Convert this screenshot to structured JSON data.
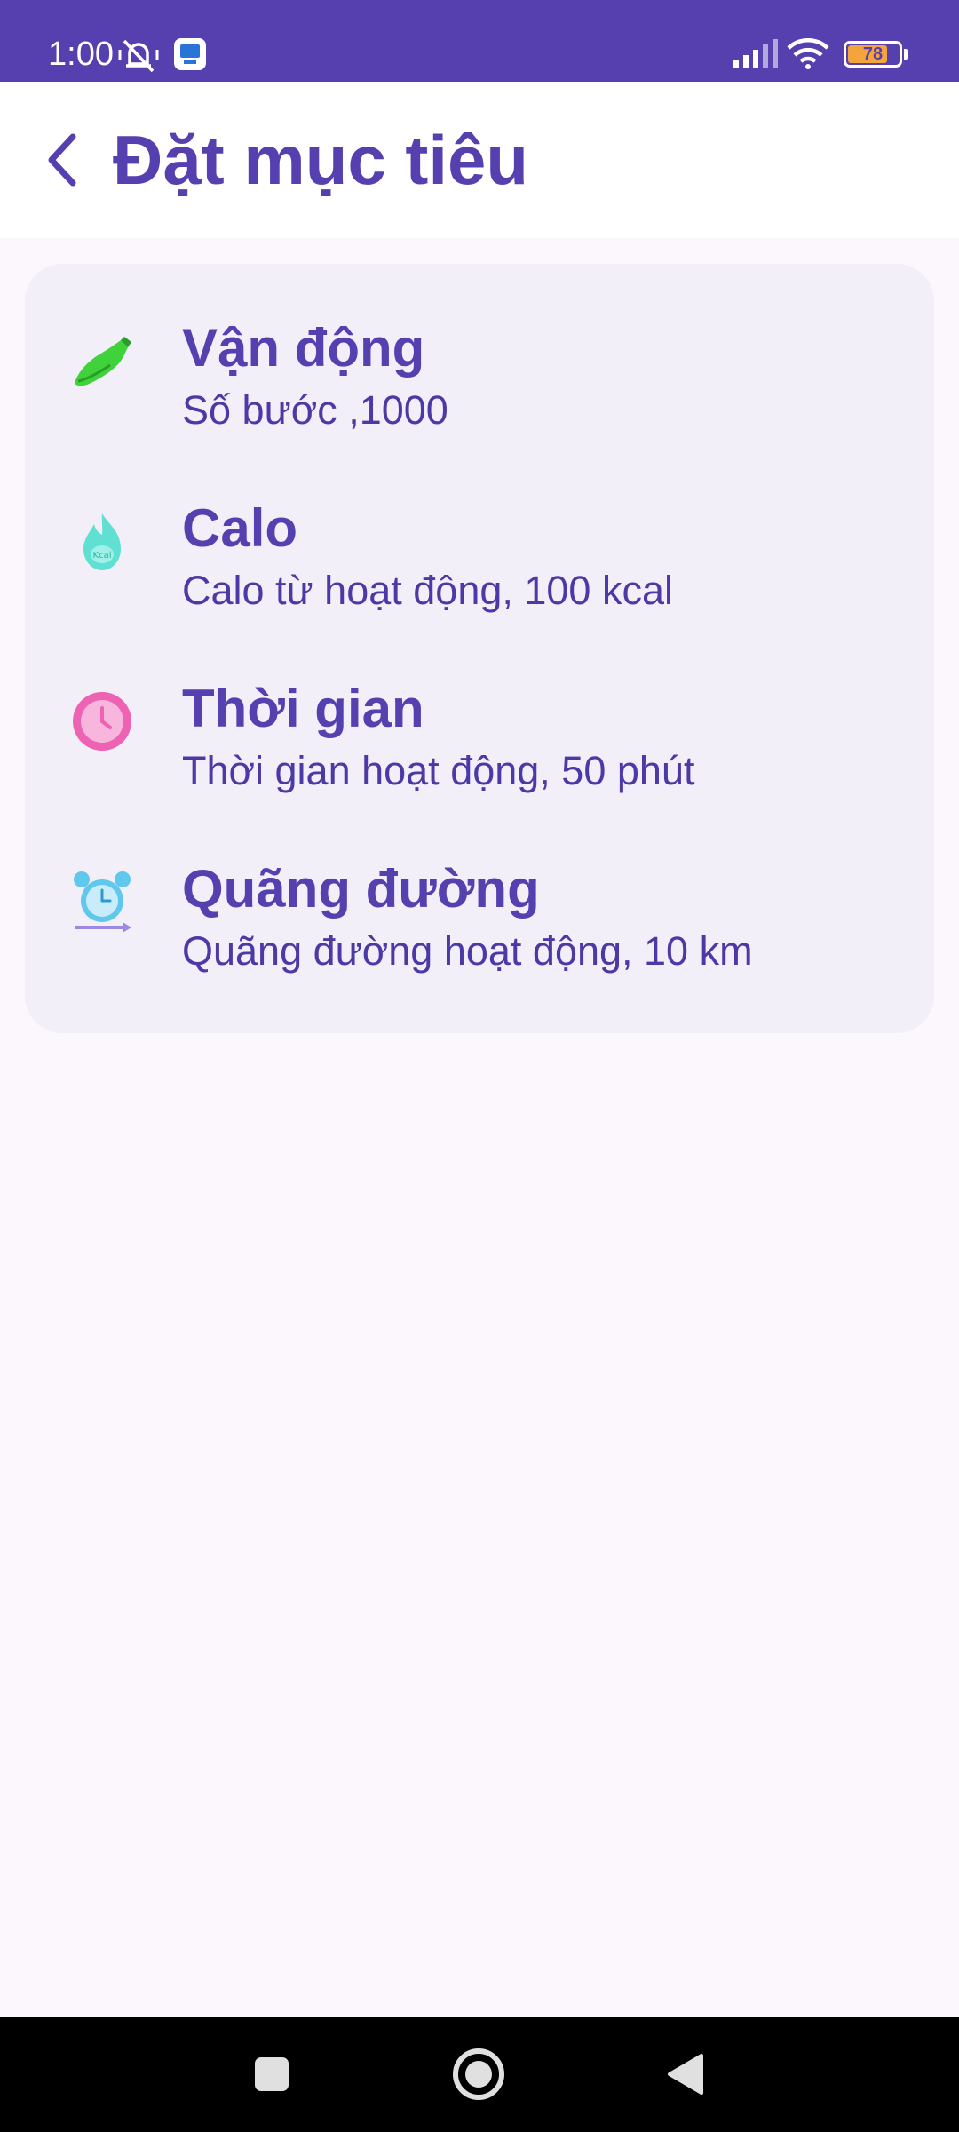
{
  "status_bar": {
    "time": "1:00",
    "battery_level": "78",
    "battery_fraction": 0.78,
    "icons": [
      "mute-vibrate-icon",
      "app-notification-icon",
      "signal-icon",
      "wifi-icon",
      "battery-icon"
    ]
  },
  "header": {
    "back_icon": "chevron-left-icon",
    "title": "Đặt mục tiêu"
  },
  "goals": [
    {
      "icon": "shoe-icon",
      "title": "Vận động",
      "subtitle": "Số bước ,1000"
    },
    {
      "icon": "flame-icon",
      "title": "Calo",
      "subtitle": "Calo từ hoạt động, 100 kcal"
    },
    {
      "icon": "clock-icon",
      "title": "Thời gian",
      "subtitle": "Thời gian hoạt động, 50 phút"
    },
    {
      "icon": "alarm-distance-icon",
      "title": "Quãng đường",
      "subtitle": "Quãng đường hoạt động, 10 km"
    }
  ],
  "nav_bar": {
    "buttons": [
      "recents-square-icon",
      "home-circle-icon",
      "back-triangle-icon"
    ]
  },
  "colors": {
    "primary": "#5640b0",
    "background": "#fcf6fd",
    "card": "#f2eff9",
    "shoe": "#3fd23a",
    "flame": "#5fe0d3",
    "clock": "#ee62b3",
    "alarm": "#5fc8ec"
  }
}
